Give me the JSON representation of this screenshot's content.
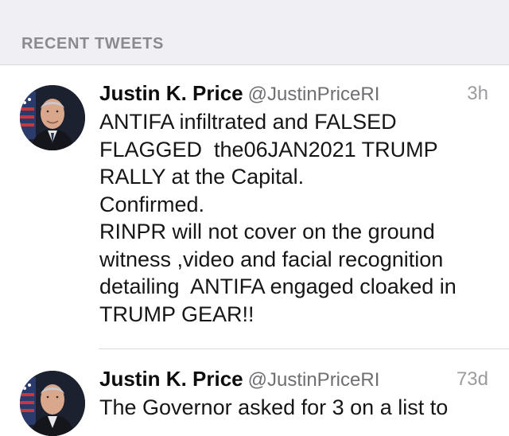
{
  "section": {
    "title": "RECENT TWEETS"
  },
  "tweets": [
    {
      "name": "Justin K. Price",
      "handle": "@JustinPriceRI",
      "time": "3h",
      "lines": [
        "ANTIFA infiltrated and FALSED",
        "FLAGGED  the06JAN2021 TRUMP",
        "RALLY at the Capital.",
        "Confirmed.",
        "RINPR will not cover on the ground",
        "witness ,video and facial recognition",
        "detailing  ANTIFA engaged cloaked in",
        "TRUMP GEAR!!"
      ]
    },
    {
      "name": "Justin K. Price",
      "handle": "@JustinPriceRI",
      "time": "73d",
      "lines": [
        "The Governor asked for 3 on a list to"
      ]
    }
  ],
  "colors": {
    "header_bg": "#efeff4",
    "header_text": "#8a8a8f",
    "timestamp": "#9b9ba0",
    "handle": "#6e6e73"
  },
  "icons": {
    "avatar": "profile-photo-avatar"
  }
}
